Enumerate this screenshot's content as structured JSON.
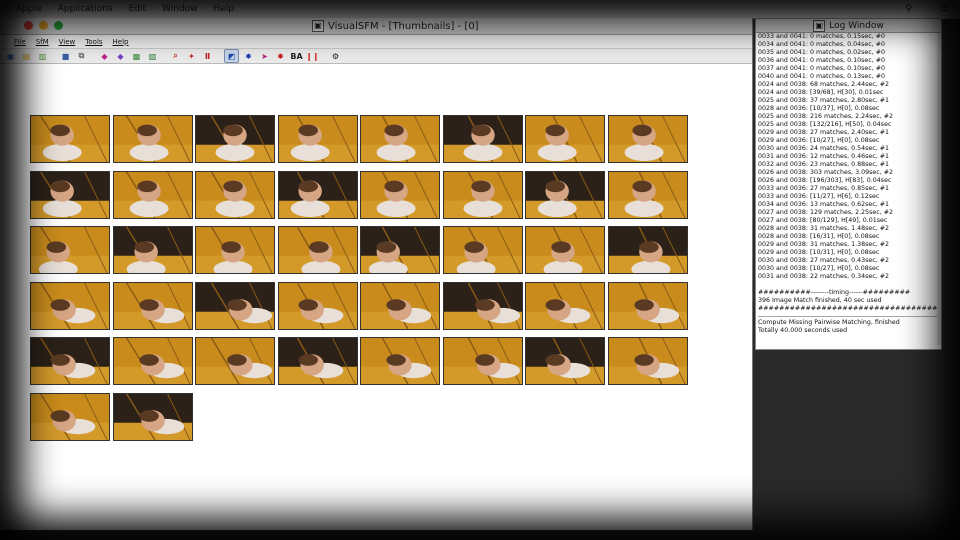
{
  "desktop": {
    "menu": [
      "Apple",
      "Applications",
      "Edit",
      "Window",
      "Help"
    ],
    "right_items": [
      "search-icon"
    ]
  },
  "main_window": {
    "title": "VisualSFM - [Thumbnails] - [0]",
    "menu": [
      "File",
      "SfM",
      "View",
      "Tools",
      "Help"
    ],
    "toolbar": [
      {
        "icon": "new-icon",
        "color": "#2a6ec0"
      },
      {
        "icon": "open-icon",
        "color": "#d9a21b"
      },
      {
        "icon": "open-multi-icon",
        "color": "#4d9a3a"
      },
      {
        "icon": "sep"
      },
      {
        "icon": "save-icon",
        "color": "#3a5fa8"
      },
      {
        "icon": "copy-icon",
        "color": "#6d6d6d"
      },
      {
        "icon": "sep"
      },
      {
        "icon": "match-icon",
        "color": "#c0208a"
      },
      {
        "icon": "pairs-icon",
        "color": "#7a3fbf"
      },
      {
        "icon": "compute-icon",
        "color": "#3a8a3a"
      },
      {
        "icon": "image-icon",
        "color": "#2a7a3a"
      },
      {
        "icon": "sep"
      },
      {
        "icon": "zoom-icon",
        "color": "#c83a2a"
      },
      {
        "icon": "points-icon",
        "color": "#c82a2a"
      },
      {
        "icon": "hist-icon",
        "color": "#c81e1e"
      },
      {
        "icon": "sep"
      },
      {
        "icon": "sfm-icon",
        "color": "#1e4aa8",
        "active": true
      },
      {
        "icon": "dense-icon",
        "color": "#1e3ab8"
      },
      {
        "icon": "arrow-icon",
        "color": "#b01e7a"
      },
      {
        "icon": "bundle-icon",
        "color": "#c8181e"
      },
      {
        "icon": "text-icon",
        "label": "BA",
        "color": "#222"
      },
      {
        "icon": "pause-icon",
        "color": "#d01818"
      },
      {
        "icon": "sep"
      },
      {
        "icon": "gear-icon",
        "color": "#222"
      }
    ]
  },
  "thumbnails": {
    "rows": [
      8,
      8,
      8,
      8,
      8,
      2
    ]
  },
  "log_window": {
    "title": "Log Window",
    "lines": [
      "0033 and 0041: 0 matches, 0.15sec, #0",
      "0034 and 0041: 0 matches, 0.04sec, #0",
      "0035 and 0041: 0 matches, 0.02sec, #0",
      "0036 and 0041: 0 matches, 0.10sec, #0",
      "0037 and 0041: 0 matches, 0.10sec, #0",
      "0040 and 0041: 0 matches, 0.13sec, #0",
      "0024 and 0038: 68 matches, 2.44sec, #2",
      "0024 and 0038: [39/68], H[30], 0.01sec",
      "0025 and 0038: 37 matches, 2.80sec, #1",
      "0028 and 0036: [10/37], H[0], 0.08sec",
      "0025 and 0038: 216 matches, 2.24sec, #2",
      "0025 and 0038: [132/216], H[50], 0.04sec",
      "0029 and 0038: 27 matches, 2.40sec, #1",
      "0029 and 0036: [10/27], H[0], 0.08sec",
      "0030 and 0036: 24 matches, 0.54sec, #1",
      "0031 and 0036: 12 matches, 0.46sec, #1",
      "0032 and 0036: 23 matches, 0.88sec, #1",
      "0026 and 0038: 303 matches, 3.09sec, #2",
      "0026 and 0038: [196/303], H[83], 0.04sec",
      "0033 and 0036: 27 matches, 0.85sec, #1",
      "0033 and 0036: [11/27], H[6], 0.12sec",
      "0034 and 0036: 13 matches, 0.62sec, #1",
      "0027 and 0038: 129 matches, 2.25sec, #2",
      "0027 and 0038: [80/129], H[49], 0.01sec",
      "0028 and 0038: 31 matches, 1.48sec, #2",
      "0028 and 0038: [16/31], H[0], 0.08sec",
      "0029 and 0038: 31 matches, 1.38sec, #2",
      "0029 and 0038: [10/31], H[0], 0.08sec",
      "0030 and 0038: 27 matches, 0.43sec, #2",
      "0030 and 0038: [10/27], H[0], 0.08sec",
      "0031 and 0038: 22 matches, 0.34sec, #2"
    ],
    "timing_line": "##########--------timing------#########",
    "finish_line": "396 Image Match finished, 40 sec used",
    "hash_line": "#####################################",
    "compute_line": "Compute Missing Pairwise Matching, finished",
    "total_line": "Totally 40.000 seconds used"
  }
}
